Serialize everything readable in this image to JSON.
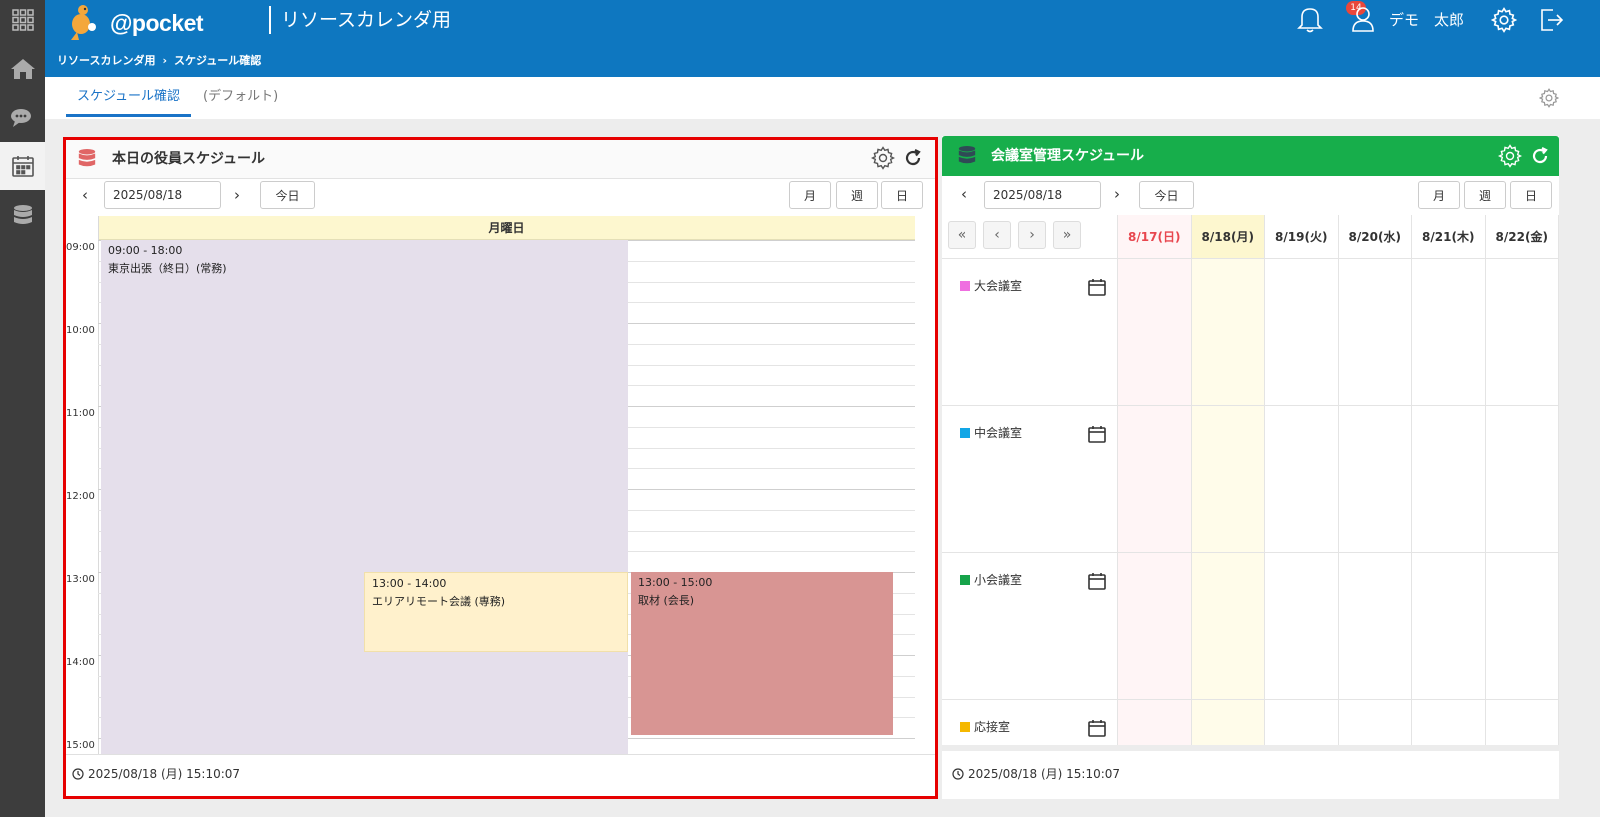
{
  "header": {
    "logo_text": "@pocket",
    "app_title": "リソースカレンダ用",
    "breadcrumb": [
      "リソースカレンダ用",
      "スケジュール確認"
    ],
    "breadcrumb_sep": "›",
    "notification_count": "14",
    "user_name": "デモ　太郎"
  },
  "tabs": {
    "active": "スケジュール確認",
    "default": "(デフォルト)"
  },
  "left_widget": {
    "title": "本日の役員スケジュール",
    "date": "2025/08/18",
    "prev": "‹",
    "next": "›",
    "today_label": "今日",
    "view_month": "月",
    "view_week": "週",
    "view_day": "日",
    "day_header": "月曜日",
    "time_labels": [
      "09:00",
      "10:00",
      "11:00",
      "12:00",
      "13:00",
      "14:00",
      "15:00"
    ],
    "events": [
      {
        "time": "09:00 - 18:00",
        "name": "東京出張（終日）(常務)",
        "color": "#e5dfeb"
      },
      {
        "time": "13:00 - 14:00",
        "name": "エリアリモート会議 (専務)",
        "color": "#fff1cc"
      },
      {
        "time": "13:00 - 15:00",
        "name": "取材 (会長)",
        "color": "#d89593"
      }
    ],
    "footer_time": "2025/08/18 (月) 15:10:07"
  },
  "right_widget": {
    "title": "会議室管理スケジュール",
    "date": "2025/08/18",
    "prev": "‹",
    "next": "›",
    "today_label": "今日",
    "view_month": "月",
    "view_week": "週",
    "view_day": "日",
    "pager": [
      "«",
      "‹",
      "›",
      "»"
    ],
    "days": [
      {
        "label": "8/17(日)",
        "type": "sunday"
      },
      {
        "label": "8/18(月)",
        "type": "today"
      },
      {
        "label": "8/19(火)",
        "type": "normal"
      },
      {
        "label": "8/20(水)",
        "type": "normal"
      },
      {
        "label": "8/21(木)",
        "type": "normal"
      },
      {
        "label": "8/22(金)",
        "type": "normal"
      }
    ],
    "rooms": [
      {
        "name": "大会議室",
        "color": "#ef6fe0"
      },
      {
        "name": "中会議室",
        "color": "#12a6e6"
      },
      {
        "name": "小会議室",
        "color": "#16a34a"
      },
      {
        "name": "応接室",
        "color": "#f5b800"
      }
    ],
    "footer_time": "2025/08/18 (月) 15:10:07"
  },
  "colors": {
    "header_bg": "#0e77c0",
    "rail_bg": "#3d3d3d",
    "right_header_bg": "#17ae4b",
    "highlight_border": "#e60000",
    "sunday_text": "#e8474f",
    "today_bg": "#fdf7cf"
  }
}
